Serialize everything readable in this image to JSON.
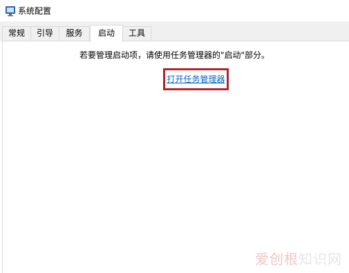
{
  "window": {
    "title": "系统配置"
  },
  "tabs": [
    {
      "label": "常规"
    },
    {
      "label": "引导"
    },
    {
      "label": "服务"
    },
    {
      "label": "启动"
    },
    {
      "label": "工具"
    }
  ],
  "active_tab": "启动",
  "startup": {
    "message": "若要管理启动项，请使用任务管理器的\"启动\"部分。",
    "link": "打开任务管理器"
  },
  "watermark": {
    "part1": "爱创根",
    "part2": "知识网"
  },
  "colors": {
    "link": "#0066cc",
    "highlight": "#b2232a"
  }
}
